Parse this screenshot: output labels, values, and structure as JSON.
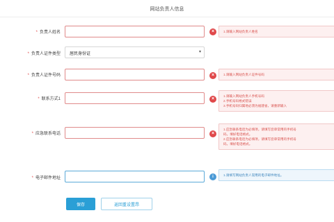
{
  "page": {
    "title": "网站负责人信息"
  },
  "form": {
    "name": {
      "label": "负责人姓名",
      "value": "",
      "error_lines": [
        "1.请输入网站负责人姓名"
      ]
    },
    "id_type": {
      "label": "负责人证件类型",
      "value": "居民身份证"
    },
    "id_number": {
      "label": "负责人证件号码",
      "value": "",
      "error_lines": [
        "1.请输入网站负责人证件号码"
      ]
    },
    "contact1": {
      "label": "联系方式1",
      "value": "",
      "error_lines": [
        "1.请输入网站负责人手机号码",
        "2.手机号码格式错误",
        "3.手机号码归属地必须为福建省，请重新输入"
      ]
    },
    "emergency": {
      "label": "应急联系电话",
      "value": "",
      "error_lines": [
        "1.应急联系电话为必填项，请填写您单常用的手机号",
        "码，填好电话格式。",
        "2.应急联系电话为必填项，请填写您单常用的手机号",
        "码，填好电话格式。"
      ]
    },
    "email": {
      "label": "电子邮件地址",
      "value": "",
      "info_lines": [
        "1.请填写网站负责人常用的电子邮件地址。"
      ]
    }
  },
  "actions": {
    "save_label": "保存",
    "back_label": "返回重设置昂"
  },
  "colors": {
    "error": "#e0484a",
    "info": "#4a9ad6",
    "primary": "#2a9fd6"
  }
}
